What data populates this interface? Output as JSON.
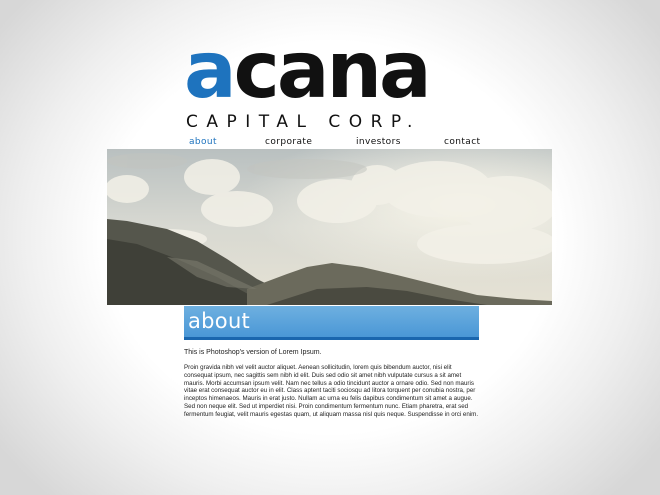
{
  "logo": {
    "word_first": "a",
    "word_rest": "cana",
    "subtitle": "CAPITAL CORP."
  },
  "nav": {
    "items": [
      {
        "label": "about"
      },
      {
        "label": "corporate"
      },
      {
        "label": "investors"
      },
      {
        "label": "contact"
      }
    ]
  },
  "hero": {
    "image": "mountain-clouds-landscape"
  },
  "section": {
    "title": "about"
  },
  "content": {
    "intro": "This is Photoshop's version  of Lorem Ipsum.",
    "body": "Proin gravida nibh vel velit auctor aliquet. Aenean sollicitudin, lorem quis bibendum auctor, nisi elit consequat ipsum, nec sagittis sem nibh id elit. Duis sed odio sit amet nibh vulputate cursus a sit amet mauris. Morbi accumsan ipsum velit. Nam nec tellus a odio tincidunt auctor a ornare odio. Sed non  mauris vitae erat consequat auctor eu in elit. Class aptent taciti sociosqu ad litora torquent per conubia nostra, per inceptos himenaeos. Mauris in erat justo. Nullam ac urna eu felis dapibus condimentum sit amet a augue. Sed non neque elit. Sed ut imperdiet nisi. Proin condimentum fermentum nunc. Etiam pharetra, erat sed fermentum feugiat, velit mauris egestas quam, ut aliquam massa nisl quis neque. Suspendisse in orci enim."
  },
  "colors": {
    "accent": "#1e73be",
    "bar": "#4a97d6",
    "text": "#222222"
  }
}
